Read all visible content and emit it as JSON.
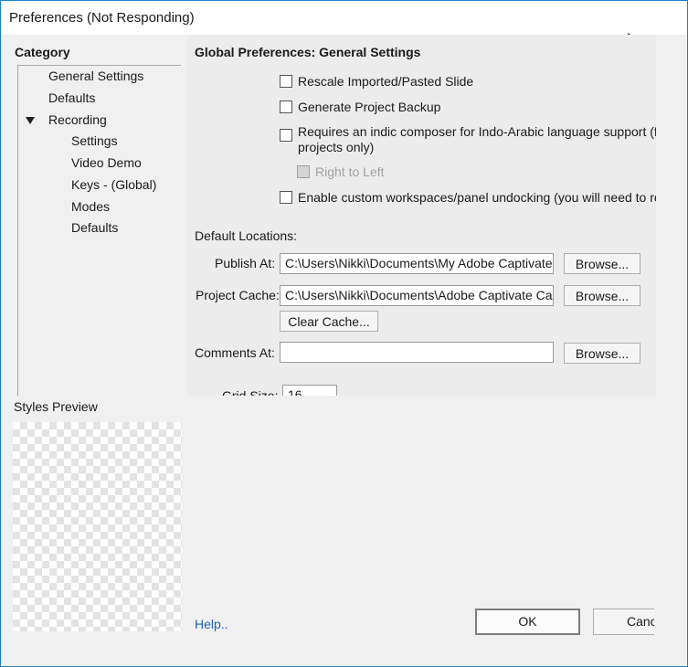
{
  "window": {
    "title": "Preferences (Not Responding)"
  },
  "category": {
    "header": "Category",
    "items": [
      {
        "label": "General Settings"
      },
      {
        "label": "Defaults"
      },
      {
        "label": "Recording",
        "arrow": "▼"
      },
      {
        "label": "Settings"
      },
      {
        "label": "Video Demo"
      },
      {
        "label": "Keys - (Global)"
      },
      {
        "label": "Modes"
      },
      {
        "label": "Defaults"
      }
    ]
  },
  "styles_preview": {
    "label": "Styles Preview"
  },
  "settings": {
    "title": "Global Preferences: General Settings",
    "checkboxes": [
      {
        "label": "Rescale Imported/Pasted Slide",
        "checked": false
      },
      {
        "label": "Generate Project Backup",
        "checked": false
      },
      {
        "label_line1": "Requires an indic composer for Indo-Arabic language support (fo",
        "label_line2": "projects only)",
        "checked": false
      },
      {
        "label": "Right to Left",
        "checked": false,
        "disabled": true
      },
      {
        "label": "Enable custom workspaces/panel undocking (you will need to re",
        "checked": false
      }
    ],
    "default_locations_label": "Default Locations:",
    "publish_at": {
      "label": "Publish At:",
      "value": "C:\\Users\\Nikki\\Documents\\My Adobe Captivate",
      "browse": "Browse..."
    },
    "project_cache": {
      "label": "Project Cache:",
      "value": "C:\\Users\\Nikki\\Documents\\Adobe Captivate Cac",
      "browse": "Browse...",
      "clear": "Clear Cache..."
    },
    "comments_at": {
      "label": "Comments At:",
      "value": "",
      "browse": "Browse..."
    },
    "grid_size": {
      "label": "Grid Size:",
      "value": "16"
    }
  },
  "footer": {
    "help": "Help..",
    "ok": "OK",
    "cancel": "Cance"
  },
  "colors": {
    "window_border": "#1e7fc4",
    "link": "#1f63b6"
  }
}
